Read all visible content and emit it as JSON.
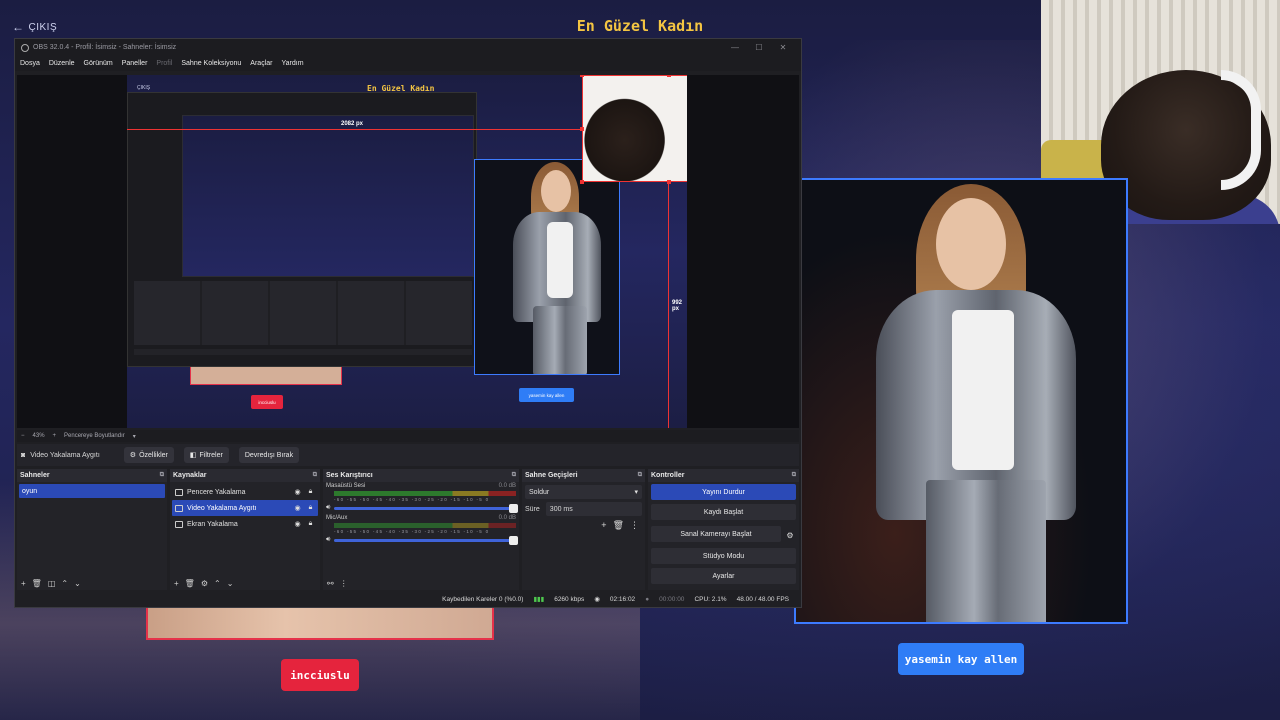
{
  "stream": {
    "exit_label": "ÇIKIŞ",
    "title": "En Güzel Kadın",
    "right_name": "yasemin kay allen",
    "left_name": "incciuslu"
  },
  "obs": {
    "window_title": "OBS 32.0.4 - Profil: İsimsiz - Sahneler: İsimsiz",
    "menu": [
      "Dosya",
      "Düzenle",
      "Görünüm",
      "Paneller",
      "Profil",
      "Sahne Koleksiyonu",
      "Araçlar",
      "Yardım"
    ],
    "menu_disabled": "Profil",
    "preview": {
      "title": "En Güzel Kadın",
      "exit_label": "ÇIKIŞ",
      "measure_width": "2082 px",
      "measure_height": "992 px",
      "name_tag": "yasemin kay allen",
      "left_tag": "incciuslu",
      "zoom": "43%",
      "zoom_mode": "Pencereye Boyutlandır"
    },
    "context_bar": {
      "source_name": "Video Yakalama Aygıtı",
      "properties": "Özellikler",
      "filters": "Filtreler",
      "deactivate": "Devredışı Bırak"
    },
    "scenes": {
      "title": "Sahneler",
      "items": [
        "oyun"
      ]
    },
    "sources": {
      "title": "Kaynaklar",
      "items": [
        {
          "name": "Pencere Yakalama",
          "selected": false
        },
        {
          "name": "Video Yakalama Aygıtı",
          "selected": true
        },
        {
          "name": "Ekran Yakalama",
          "selected": false
        }
      ]
    },
    "mixer": {
      "title": "Ses Karıştırıcı",
      "channels": [
        {
          "name": "Masaüstü Sesi",
          "db": "0.0 dB"
        },
        {
          "name": "Mic/Aux",
          "db": "0.0 dB"
        }
      ],
      "scale": "-60 -55 -50 -45 -40 -35 -30 -25 -20 -15 -10 -5 0"
    },
    "transitions": {
      "title": "Sahne Geçişleri",
      "selected": "Soldur",
      "duration_label": "Süre",
      "duration_value": "300 ms"
    },
    "controls": {
      "title": "Kontroller",
      "buttons": [
        "Yayını Durdur",
        "Kaydı Başlat",
        "Sanal Kamerayı Başlat",
        "Stüdyo Modu",
        "Ayarlar"
      ]
    },
    "status": {
      "dropped": "Kaybedilen Kareler 0 (%0.0)",
      "bitrate": "6260 kbps",
      "stream_time": "02:16:02",
      "record_time": "00:00:00",
      "cpu": "CPU: 2.1%",
      "fps": "48.00 / 48.00 FPS"
    }
  }
}
